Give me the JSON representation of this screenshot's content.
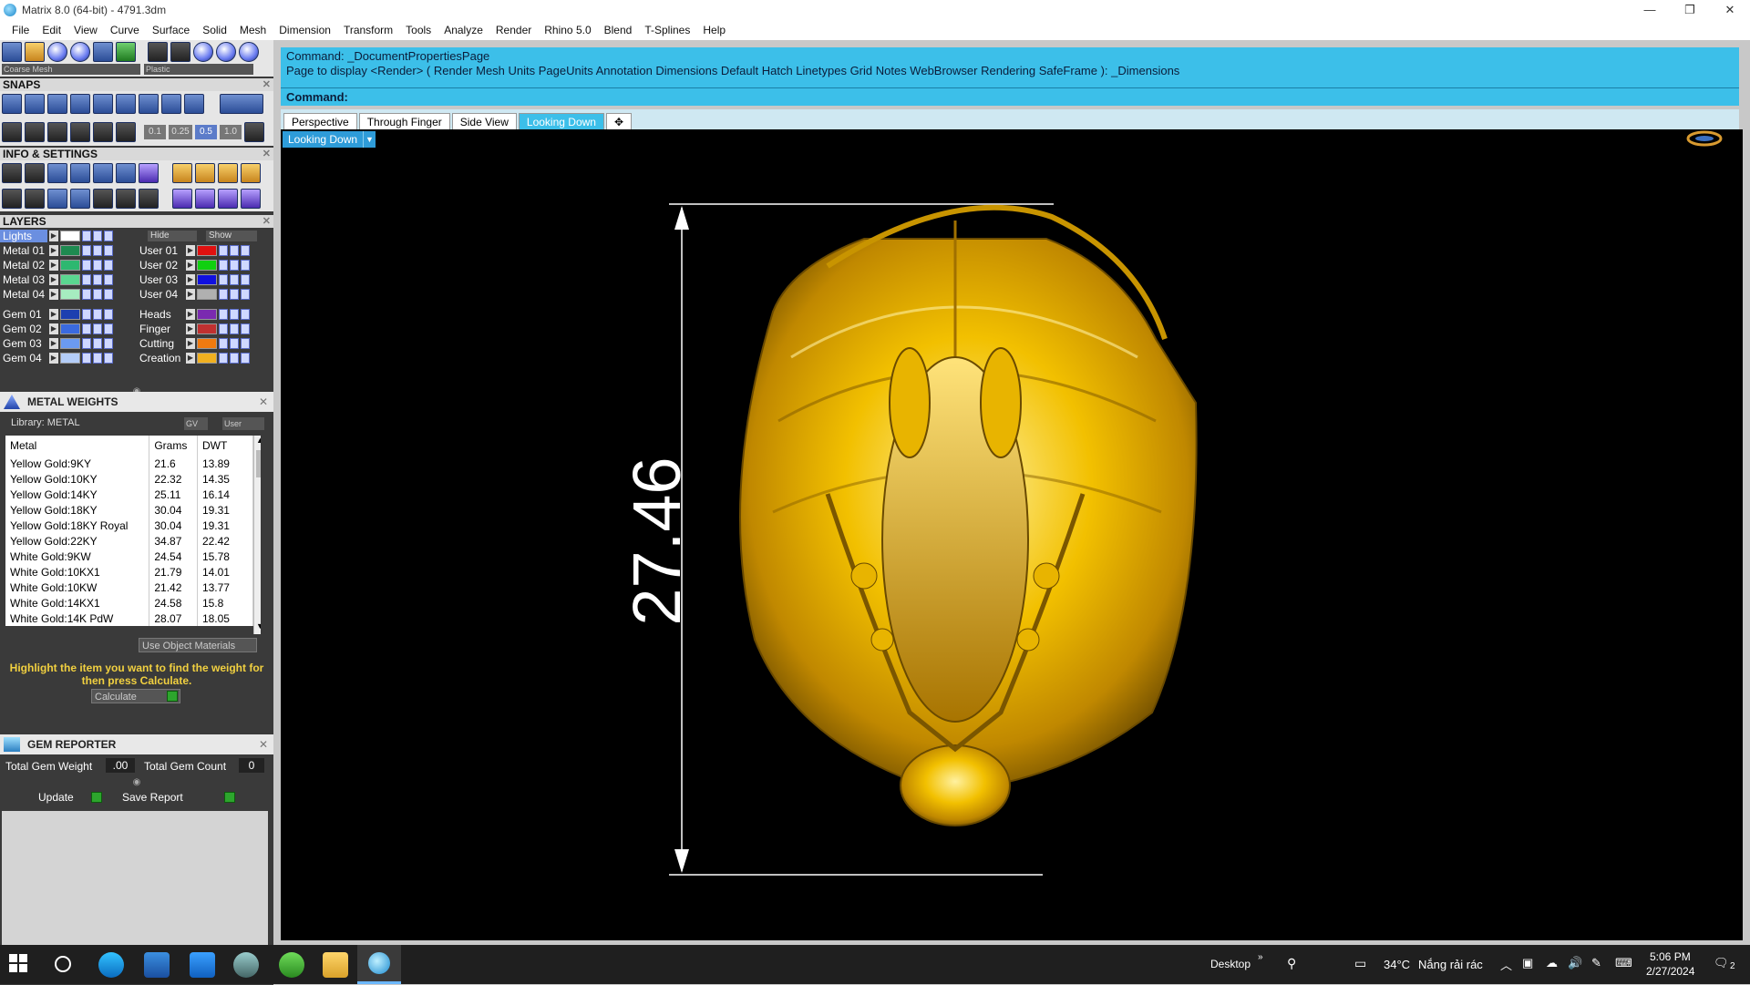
{
  "window": {
    "title": "Matrix 8.0 (64-bit) - 4791.3dm",
    "controls": [
      "—",
      "❐",
      "✕"
    ]
  },
  "menu": [
    "File",
    "Edit",
    "View",
    "Curve",
    "Surface",
    "Solid",
    "Mesh",
    "Dimension",
    "Transform",
    "Tools",
    "Analyze",
    "Render",
    "Rhino 5.0",
    "Blend",
    "T-Splines",
    "Help"
  ],
  "toolbar": {
    "mesh_select": "Coarse Mesh",
    "material_select": "Plastic"
  },
  "snaps": {
    "title": "SNAPS",
    "values": [
      "0.1",
      "0.25",
      "0.5",
      "1.0"
    ]
  },
  "info_settings": {
    "title": "INFO & SETTINGS"
  },
  "layers": {
    "title": "LAYERS",
    "lights": "Lights",
    "hide_label": "Hide",
    "show_label": "Show",
    "left": [
      {
        "name": "Metal 01",
        "color": "#1e8a50"
      },
      {
        "name": "Metal 02",
        "color": "#2db870"
      },
      {
        "name": "Metal 03",
        "color": "#5ad690"
      },
      {
        "name": "Metal 04",
        "color": "#a6ecc0"
      },
      {
        "name": "Gem 01",
        "color": "#1c3fb0"
      },
      {
        "name": "Gem 02",
        "color": "#3a6ae0"
      },
      {
        "name": "Gem 03",
        "color": "#6b9af0"
      },
      {
        "name": "Gem 04",
        "color": "#b4cdf8"
      }
    ],
    "right": [
      {
        "name": "User 01",
        "color": "#e01010"
      },
      {
        "name": "User 02",
        "color": "#10d010"
      },
      {
        "name": "User 03",
        "color": "#1010e0"
      },
      {
        "name": "User 04",
        "color": "#b0b0b0"
      },
      {
        "name": "Heads",
        "color": "#7a2ab0"
      },
      {
        "name": "Finger",
        "color": "#c03030"
      },
      {
        "name": "Cutting",
        "color": "#f07a10"
      },
      {
        "name": "Creation",
        "color": "#f0b020"
      }
    ]
  },
  "metal_weights": {
    "title": "METAL WEIGHTS",
    "library": "Library: METAL",
    "gv_label": "GV",
    "user_label": "User",
    "columns": [
      "Metal",
      "Grams",
      "DWT"
    ],
    "rows": [
      [
        "Yellow Gold:9KY",
        "21.6",
        "13.89"
      ],
      [
        "Yellow Gold:10KY",
        "22.32",
        "14.35"
      ],
      [
        "Yellow Gold:14KY",
        "25.11",
        "16.14"
      ],
      [
        "Yellow Gold:18KY",
        "30.04",
        "19.31"
      ],
      [
        "Yellow Gold:18KY Royal",
        "30.04",
        "19.31"
      ],
      [
        "Yellow Gold:22KY",
        "34.87",
        "22.42"
      ],
      [
        "White Gold:9KW",
        "24.54",
        "15.78"
      ],
      [
        "White Gold:10KX1",
        "21.79",
        "14.01"
      ],
      [
        "White Gold:10KW",
        "21.42",
        "13.77"
      ],
      [
        "White Gold:14KX1",
        "24.58",
        "15.8"
      ],
      [
        "White Gold:14K PdW",
        "28.07",
        "18.05"
      ]
    ],
    "use_object_materials": "Use Object Materials",
    "hint": "Highlight the item you want to find the weight for then press Calculate.",
    "calculate": "Calculate"
  },
  "gem_reporter": {
    "title": "GEM REPORTER",
    "total_weight_label": "Total Gem Weight",
    "total_weight_value": ".00",
    "total_count_label": "Total Gem Count",
    "total_count_value": "0",
    "update": "Update",
    "save_report": "Save Report"
  },
  "command": {
    "line1": "Command: _DocumentPropertiesPage",
    "line2": "Page to display <Render> ( Render  Mesh  Units  PageUnits  Annotation  Dimensions  Default  Hatch  Linetypes  Grid  Notes  WebBrowser  Rendering  SafeFrame ): _Dimensions",
    "prompt": "Command:"
  },
  "viewport_tabs": [
    "Perspective",
    "Through Finger",
    "Side View",
    "Looking Down",
    "✥"
  ],
  "viewport": {
    "label": "Looking Down",
    "dimension": "27.46",
    "model_color": "#d8a400"
  },
  "taskbar": {
    "desktop": "Desktop",
    "temperature": "34°C",
    "weather": "Nắng rải rác",
    "time": "5:06 PM",
    "date": "2/27/2024",
    "notifications": "2"
  }
}
